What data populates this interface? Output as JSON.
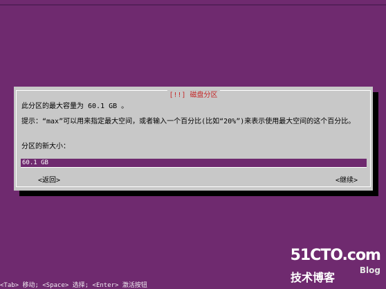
{
  "dialog": {
    "title": "[!!] 磁盘分区",
    "max_capacity_text": "此分区的最大容量为 60.1 GB 。",
    "hint_text": "提示：“max”可以用来指定最大空间，或者输入一个百分比(比如“20%”)来表示使用最大空间的这个百分比。",
    "new_size_label": "分区的新大小：",
    "size_input_value": "60.1 GB",
    "back_button": "<返回>",
    "continue_button": "<继续>"
  },
  "help_line": "<Tab> 移动; <Space> 选择; <Enter> 激活按钮",
  "watermark": {
    "site": "51CTO.com",
    "tech": "技术博客",
    "blog": "Blog"
  }
}
